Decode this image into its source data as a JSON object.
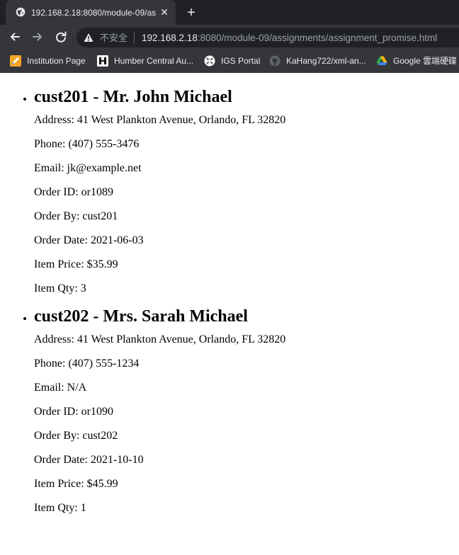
{
  "browser": {
    "tab": {
      "title": "192.168.2.18:8080/module-09/as",
      "close_glyph": "✕",
      "favicon_icon": "globe-icon"
    },
    "new_tab_glyph": "+",
    "address_bar": {
      "security_label": "不安全",
      "url_host": "192.168.2.18",
      "url_rest": ":8080/module-09/assignments/assignment_promise.html"
    },
    "bookmarks": [
      {
        "label": "Institution Page",
        "icon": "pencil-icon",
        "color": "#f5a623"
      },
      {
        "label": "Humber Central Au...",
        "icon": "humber-icon",
        "color": "#ffffff"
      },
      {
        "label": "IGS Portal",
        "icon": "igs-icon",
        "color": "#ffffff"
      },
      {
        "label": "KaHang722/xml-an...",
        "icon": "github-icon",
        "color": "#9aa0a6"
      },
      {
        "label": "Google 雲端硬碟",
        "icon": "google-drive-icon",
        "color": "#34a853"
      }
    ]
  },
  "customers": [
    {
      "heading": "cust201 - Mr. John Michael",
      "fields": [
        "Address: 41 West Plankton Avenue, Orlando, FL 32820",
        "Phone: (407) 555-3476",
        "Email: jk@example.net",
        "Order ID: or1089",
        "Order By: cust201",
        "Order Date: 2021-06-03",
        "Item Price: $35.99",
        "Item Qty: 3"
      ]
    },
    {
      "heading": "cust202 - Mrs. Sarah Michael",
      "fields": [
        "Address: 41 West Plankton Avenue, Orlando, FL 32820",
        "Phone: (407) 555-1234",
        "Email: N/A",
        "Order ID: or1090",
        "Order By: cust202",
        "Order Date: 2021-10-10",
        "Item Price: $45.99",
        "Item Qty: 1"
      ]
    }
  ]
}
